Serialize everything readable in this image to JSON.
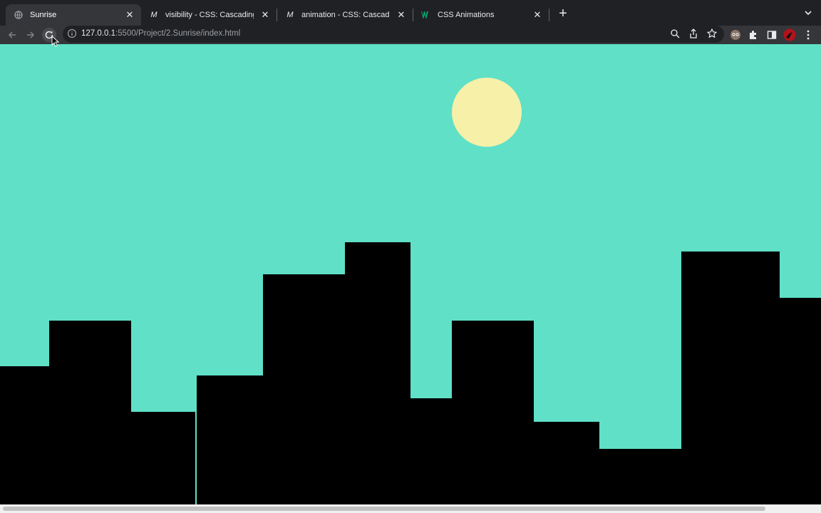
{
  "tabs": [
    {
      "title": "Sunrise",
      "icon": "globe-icon",
      "active": true
    },
    {
      "title": "visibility - CSS: Cascading Style",
      "icon": "mdn-icon",
      "active": false
    },
    {
      "title": "animation - CSS: Cascading Style",
      "icon": "mdn-icon",
      "active": false
    },
    {
      "title": "CSS Animations",
      "icon": "w3schools-icon",
      "active": false
    }
  ],
  "address": {
    "host": "127.0.0.1",
    "path": ":5500/Project/2.Sunrise/index.html"
  },
  "colors": {
    "sky": "#5fe0c7",
    "sun": "#f7f0a9",
    "buildings": "#000000",
    "chrome_dark": "#202124",
    "chrome_mid": "#35363a"
  }
}
